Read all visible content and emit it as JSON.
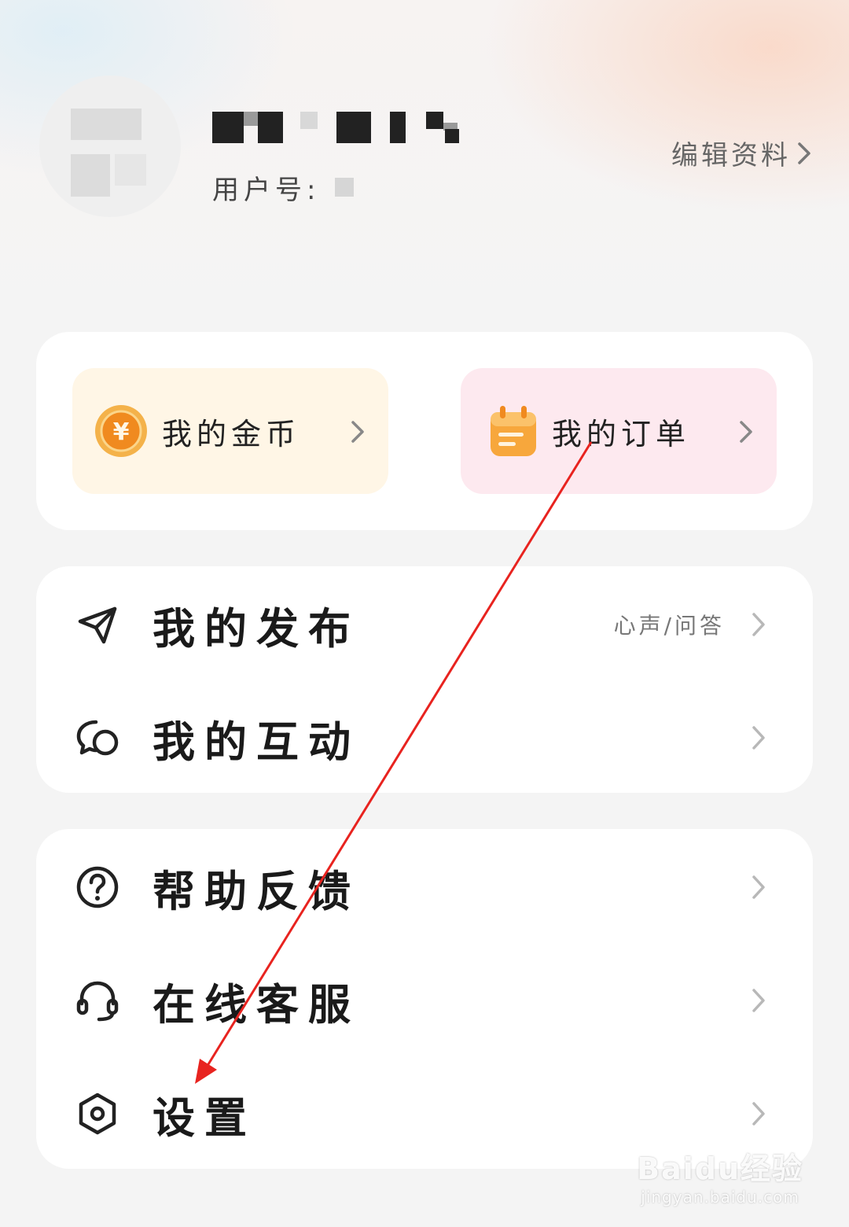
{
  "profile": {
    "user_id_label": "用户号:",
    "edit_label": "编辑资料"
  },
  "shortcuts": [
    {
      "label": "我的金币",
      "icon": "coin-icon",
      "bg": "#fff6e6"
    },
    {
      "label": "我的订单",
      "icon": "calendar-icon",
      "bg": "#fde9ef"
    }
  ],
  "menu_group_1": [
    {
      "label": "我的发布",
      "icon": "send-icon",
      "subtitle": "心声/问答"
    },
    {
      "label": "我的互动",
      "icon": "chat-bubbles-icon"
    }
  ],
  "menu_group_2": [
    {
      "label": "帮助反馈",
      "icon": "help-circle-icon"
    },
    {
      "label": "在线客服",
      "icon": "headset-icon"
    },
    {
      "label": "设置",
      "icon": "settings-hexagon-icon"
    }
  ],
  "annotation": {
    "color": "#e8231f"
  },
  "watermark": {
    "brand": "Baidu经验",
    "url": "jingyan.baidu.com"
  }
}
